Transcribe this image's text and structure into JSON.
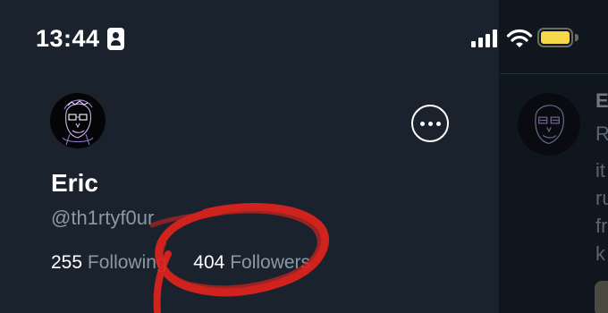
{
  "status_bar": {
    "time": "13:44",
    "icons": [
      "id-card-icon",
      "cellular-signal-icon",
      "wifi-icon",
      "battery-icon"
    ],
    "battery_color": "#f7d84b"
  },
  "profile": {
    "display_name": "Eric",
    "handle": "@th1rtyf0ur",
    "following_count": "255",
    "following_label": "Following",
    "followers_count": "404",
    "followers_label": "Followers"
  },
  "menu": {
    "more_icon": "more-options-icon"
  },
  "background_feed": {
    "line_fragments": [
      "E",
      "R",
      "it",
      "ru",
      "fr",
      "k"
    ]
  },
  "colors": {
    "drawer_bg": "#1a222d",
    "text_primary": "#ffffff",
    "text_secondary": "#8b98a6",
    "annotation_red": "#e0241c"
  }
}
